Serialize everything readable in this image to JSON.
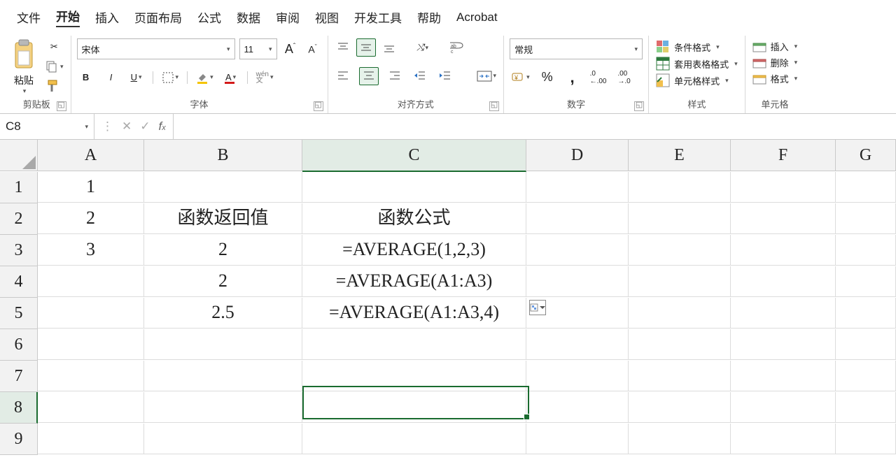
{
  "menu": [
    "文件",
    "开始",
    "插入",
    "页面布局",
    "公式",
    "数据",
    "审阅",
    "视图",
    "开发工具",
    "帮助",
    "Acrobat"
  ],
  "active_menu_index": 1,
  "ribbon": {
    "clipboard": {
      "paste": "粘贴",
      "label": "剪贴板"
    },
    "font": {
      "name": "宋体",
      "size": "11",
      "label": "字体"
    },
    "align": {
      "merge": "合并后居中",
      "label": "对齐方式"
    },
    "number": {
      "format": "常规",
      "label": "数字"
    },
    "styles": {
      "cond": "条件格式",
      "table": "套用表格格式",
      "cellstyle": "单元格样式",
      "label": "样式"
    },
    "cells": {
      "insert": "插入",
      "delete": "删除",
      "format": "格式",
      "label": "单元格"
    }
  },
  "namebox": "C8",
  "formula": "",
  "columns": [
    "A",
    "B",
    "C",
    "D",
    "E",
    "F",
    "G"
  ],
  "selected_col_index": 2,
  "rows": [
    "1",
    "2",
    "3",
    "4",
    "5",
    "6",
    "7",
    "8",
    "9"
  ],
  "selected_row_index": 7,
  "cells": {
    "A1": "1",
    "A2": "2",
    "A3": "3",
    "B2": "函数返回值",
    "B3": "2",
    "B4": "2",
    "B5": "2.5",
    "C2": "函数公式",
    "C3": "=AVERAGE(1,2,3)",
    "C4": "=AVERAGE(A1:A3)",
    "C5": "=AVERAGE(A1:A3,4)"
  },
  "selection": {
    "col": "C",
    "row": "8"
  }
}
